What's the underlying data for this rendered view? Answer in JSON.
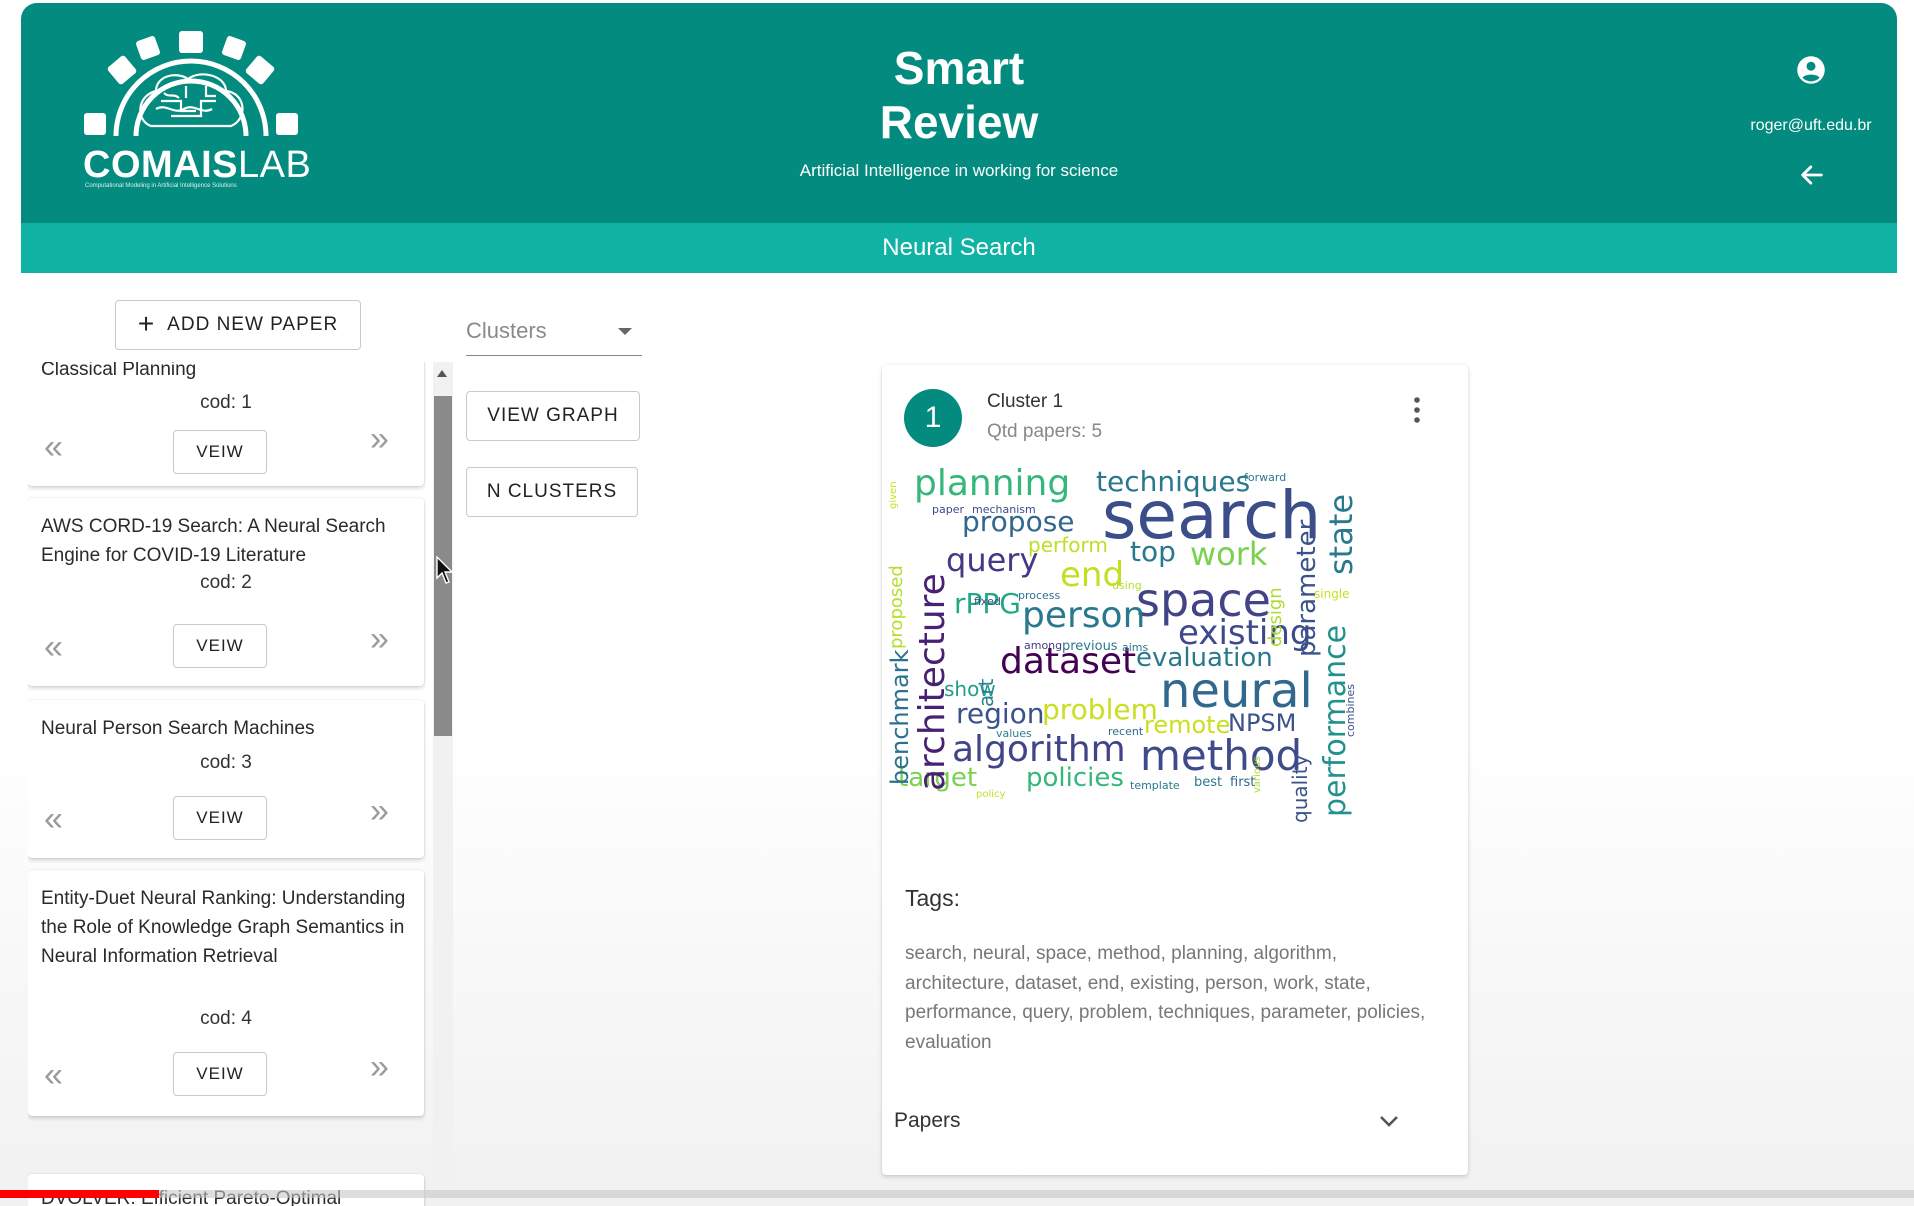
{
  "header": {
    "logo_text_bold": "COMAIS",
    "logo_text_light": "LAB",
    "logo_subtext": "Computational Modeling in Artificial Intelligence Solutions",
    "title_line1": "Smart",
    "title_line2": "Review",
    "subtitle": "Artificial Intelligence in working for science",
    "user_email": "roger@uft.edu.br",
    "account_icon": "account-circle-icon",
    "back_icon": "arrow-left-icon",
    "color": "#028b7e"
  },
  "subbar": {
    "title": "Neural Search",
    "color": "#10b2a4"
  },
  "add_paper": {
    "label": "ADD NEW PAPER",
    "icon": "plus-icon"
  },
  "papers": [
    {
      "title": "Learning Neural Search Policies for Classical Planning",
      "cod": "cod: 1",
      "view_label": "VEIW",
      "prev": "«",
      "next": "»"
    },
    {
      "title": "AWS CORD-19 Search: A Neural Search Engine for COVID-19 Literature",
      "cod": "cod: 2",
      "view_label": "VEIW",
      "prev": "«",
      "next": "»"
    },
    {
      "title": "Neural Person Search Machines",
      "cod": "cod: 3",
      "view_label": "VEIW",
      "prev": "«",
      "next": "»"
    },
    {
      "title": "Entity-Duet Neural Ranking: Understanding the Role of Knowledge Graph Semantics in Neural Information Retrieval",
      "cod": "cod: 4",
      "view_label": "VEIW",
      "prev": "«",
      "next": "»"
    },
    {
      "title": "DVOLVER: Efficient Pareto-Optimal"
    }
  ],
  "controls": {
    "clusters_placeholder": "Clusters",
    "view_graph": "VIEW GRAPH",
    "n_clusters": "N CLUSTERS"
  },
  "cluster": {
    "number": "1",
    "name": "Cluster 1",
    "count": "Qtd papers: 5",
    "menu_icon": "more-vertical-icon",
    "tags_label": "Tags:",
    "tags": "search, neural, space, method, planning, algorithm, architecture, dataset, end, existing, person, work, state, performance, query, problem, techniques, parameter, policies, evaluation",
    "papers_label": "Papers",
    "expand_icon": "chevron-down-icon",
    "wordcloud": [
      {
        "t": "search",
        "c": "#3b4e8a"
      },
      {
        "t": "planning",
        "c": "#35b779"
      },
      {
        "t": "techniques",
        "c": "#2a788e"
      },
      {
        "t": "propose",
        "c": "#31688e"
      },
      {
        "t": "query",
        "c": "#443983"
      },
      {
        "t": "perform",
        "c": "#bddf26"
      },
      {
        "t": "top",
        "c": "#2a788e"
      },
      {
        "t": "work",
        "c": "#7ad151"
      },
      {
        "t": "end",
        "c": "#c2df23"
      },
      {
        "t": "space",
        "c": "#414487"
      },
      {
        "t": "rPPG",
        "c": "#22a884"
      },
      {
        "t": "person",
        "c": "#2a788e"
      },
      {
        "t": "existing",
        "c": "#3e4a89"
      },
      {
        "t": "dataset",
        "c": "#440154"
      },
      {
        "t": "evaluation",
        "c": "#2a788e"
      },
      {
        "t": "neural",
        "c": "#31688e"
      },
      {
        "t": "show",
        "c": "#1f9e89"
      },
      {
        "t": "region",
        "c": "#3b528b"
      },
      {
        "t": "problem",
        "c": "#c8e020"
      },
      {
        "t": "remote",
        "c": "#c8e020"
      },
      {
        "t": "NPSM",
        "c": "#3b528b"
      },
      {
        "t": "algorithm",
        "c": "#414487"
      },
      {
        "t": "method",
        "c": "#3e4a89"
      },
      {
        "t": "target",
        "c": "#7ad151"
      },
      {
        "t": "policies",
        "c": "#35b779"
      },
      {
        "t": "architecture",
        "c": "#482173"
      },
      {
        "t": "benchmark",
        "c": "#2c728e"
      },
      {
        "t": "proposed",
        "c": "#b5de2b"
      },
      {
        "t": "art",
        "c": "#26828e"
      },
      {
        "t": "parameter",
        "c": "#3b528b"
      },
      {
        "t": "design",
        "c": "#addc30"
      },
      {
        "t": "state",
        "c": "#2a788e"
      },
      {
        "t": "performance",
        "c": "#21918c"
      },
      {
        "t": "quality",
        "c": "#3b528b"
      },
      {
        "t": "paper",
        "c": "#3e4a89"
      },
      {
        "t": "mechanism",
        "c": "#3e4a89"
      },
      {
        "t": "fixed",
        "c": "#3e4a89"
      },
      {
        "t": "process",
        "c": "#2c728e"
      },
      {
        "t": "among",
        "c": "#443983"
      },
      {
        "t": "previous",
        "c": "#2a788e"
      },
      {
        "t": "aims",
        "c": "#2a788e"
      },
      {
        "t": "values",
        "c": "#26828e"
      },
      {
        "t": "recent",
        "c": "#31688e"
      },
      {
        "t": "template",
        "c": "#2a788e"
      },
      {
        "t": "best",
        "c": "#2a788e"
      },
      {
        "t": "first",
        "c": "#31688e"
      },
      {
        "t": "forward",
        "c": "#2a788e"
      },
      {
        "t": "single",
        "c": "#c8e020"
      },
      {
        "t": "combines",
        "c": "#3b528b"
      },
      {
        "t": "using",
        "c": "#b5de2b"
      },
      {
        "t": "policy",
        "c": "#c2df23"
      },
      {
        "t": "various",
        "c": "#addc30"
      },
      {
        "t": "given",
        "c": "#c8e020"
      }
    ]
  },
  "video_progress": 0.083
}
